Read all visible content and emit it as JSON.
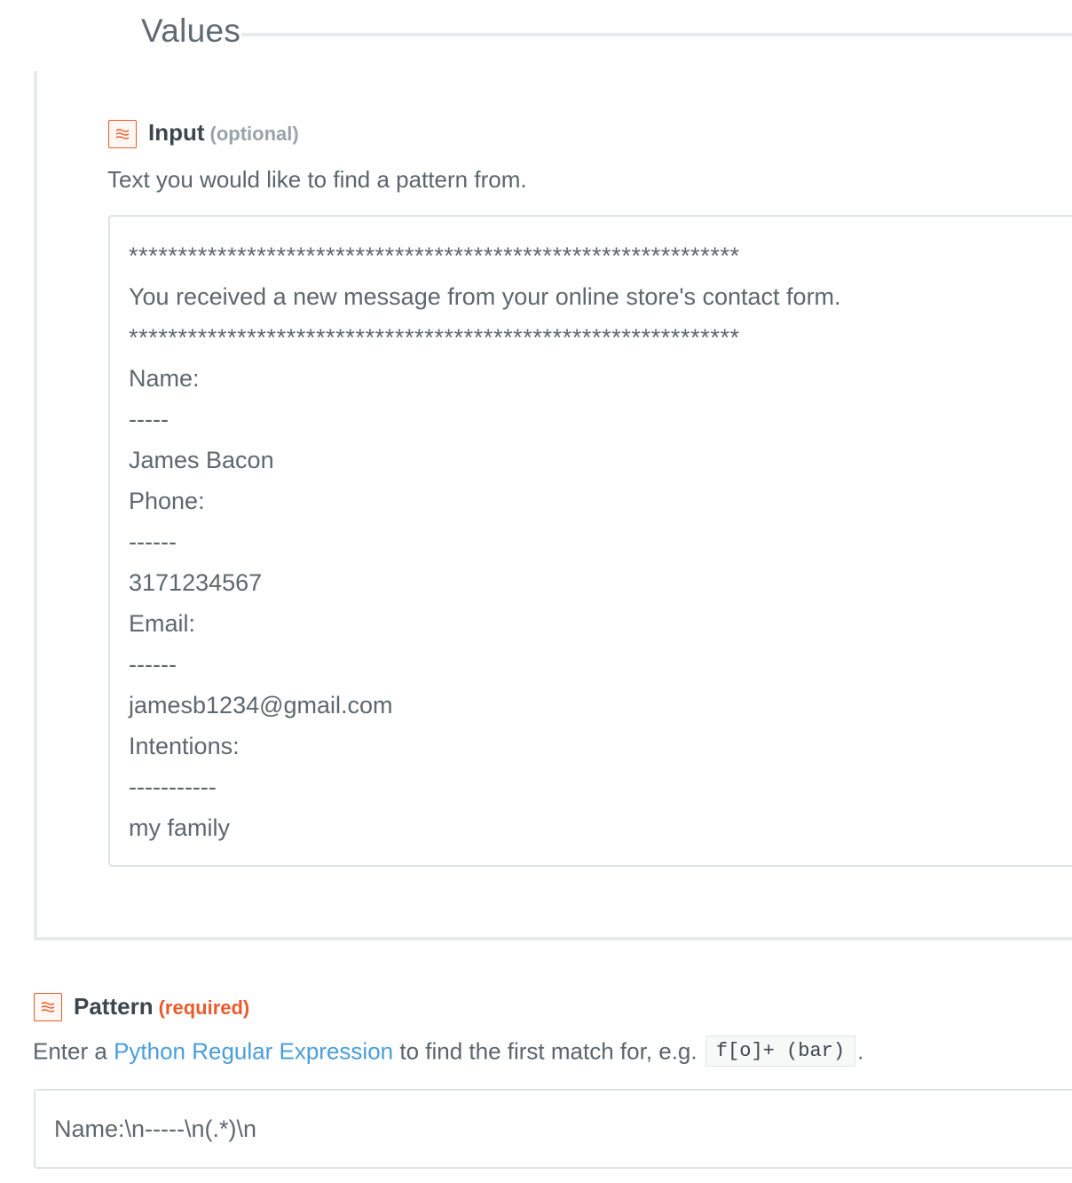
{
  "fieldset": {
    "legend": "Values"
  },
  "input_field": {
    "label": "Input",
    "tag": "(optional)",
    "icon": "formatter-icon",
    "help": "Text you would like to find a pattern from.",
    "lines": [
      "**************************************************************",
      "You received a new message from your online store's contact form.",
      "**************************************************************",
      "Name:",
      "-----",
      "James Bacon",
      "Phone:",
      "------",
      "3171234567",
      "Email:",
      "------",
      "jamesb1234@gmail.com",
      "Intentions:",
      "-----------",
      "my family"
    ]
  },
  "pattern_field": {
    "label": "Pattern",
    "tag": "(required)",
    "icon": "formatter-icon",
    "help_prefix": "Enter a ",
    "help_link": "Python Regular Expression",
    "help_middle": " to find the first match for, e.g. ",
    "help_code": "f[o]+ (bar)",
    "help_suffix": ".",
    "value": "Name:\\n-----\\n(.*)\\n"
  },
  "colors": {
    "accent": "#ee5a2a",
    "link": "#4a9edb",
    "border": "#dfe3e5"
  }
}
